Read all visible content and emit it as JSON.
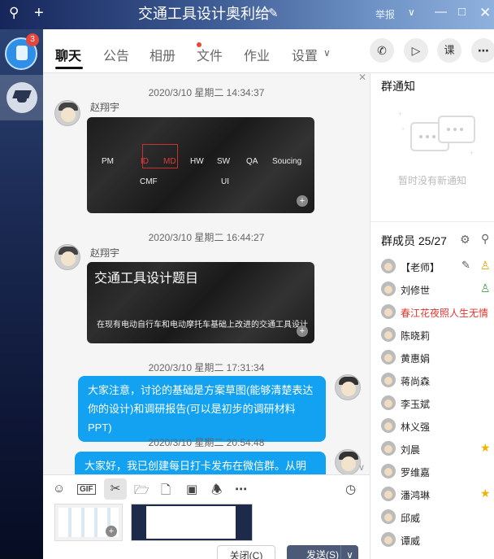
{
  "titlebar": {
    "title": "交通工具设计奥利给",
    "report_label": "举报",
    "icons": [
      "search-icon",
      "plus-icon",
      "edit-icon",
      "chevron-down-icon",
      "minimize-icon",
      "maximize-icon",
      "close-icon"
    ]
  },
  "sidebar": {
    "badge_count": "3"
  },
  "tabs": [
    {
      "label": "聊天"
    },
    {
      "label": "公告"
    },
    {
      "label": "相册"
    },
    {
      "label": "文件"
    },
    {
      "label": "作业"
    },
    {
      "label": "设置"
    }
  ],
  "action_buttons": {
    "class_label": "课"
  },
  "messages": [
    {
      "timestamp": "2020/3/10 星期二 14:34:37",
      "sender": "赵翔宇",
      "image_words": [
        "PM",
        "ID",
        "MD",
        "HW",
        "SW",
        "QA",
        "Soucing",
        "CMF",
        "UI"
      ]
    },
    {
      "timestamp": "2020/3/10 星期二 16:44:27",
      "sender": "赵翔宇",
      "image_title": "交通工具设计题目",
      "image_subtitle": "在现有电动自行车和电动摩托车基础上改进的交通工具设计"
    },
    {
      "timestamp": "2020/3/10 星期二 17:31:34",
      "text": "大家注意，讨论的基础是方案草图(能够清楚表达你的设计)和调研报告(可以是初步的调研材料PPT)"
    },
    {
      "timestamp": "2020/3/10 星期二 20:54:48",
      "text": "大家好，我已创建每日打卡发布在微信群。从明天"
    }
  ],
  "composer": {
    "gif_label": "GIF",
    "close_label": "关闭(C)",
    "send_label": "发送(S)"
  },
  "notice": {
    "title": "群通知",
    "empty_text": "暂时没有新通知"
  },
  "members": {
    "title": "群成员 25/27",
    "list": [
      {
        "name": "【老师】",
        "badge": "teacher"
      },
      {
        "name": "刘修世",
        "badge": "admin"
      },
      {
        "name": "春江花夜照人生无情",
        "highlight": true
      },
      {
        "name": "陈晓莉"
      },
      {
        "name": "黄惠娟"
      },
      {
        "name": "蒋尚森"
      },
      {
        "name": "李玉斌"
      },
      {
        "name": "林义强"
      },
      {
        "name": "刘晨",
        "badge": "star"
      },
      {
        "name": "罗维嘉"
      },
      {
        "name": "潘鸿琳",
        "badge": "star"
      },
      {
        "name": "邱威"
      },
      {
        "name": "谭威"
      }
    ]
  }
}
